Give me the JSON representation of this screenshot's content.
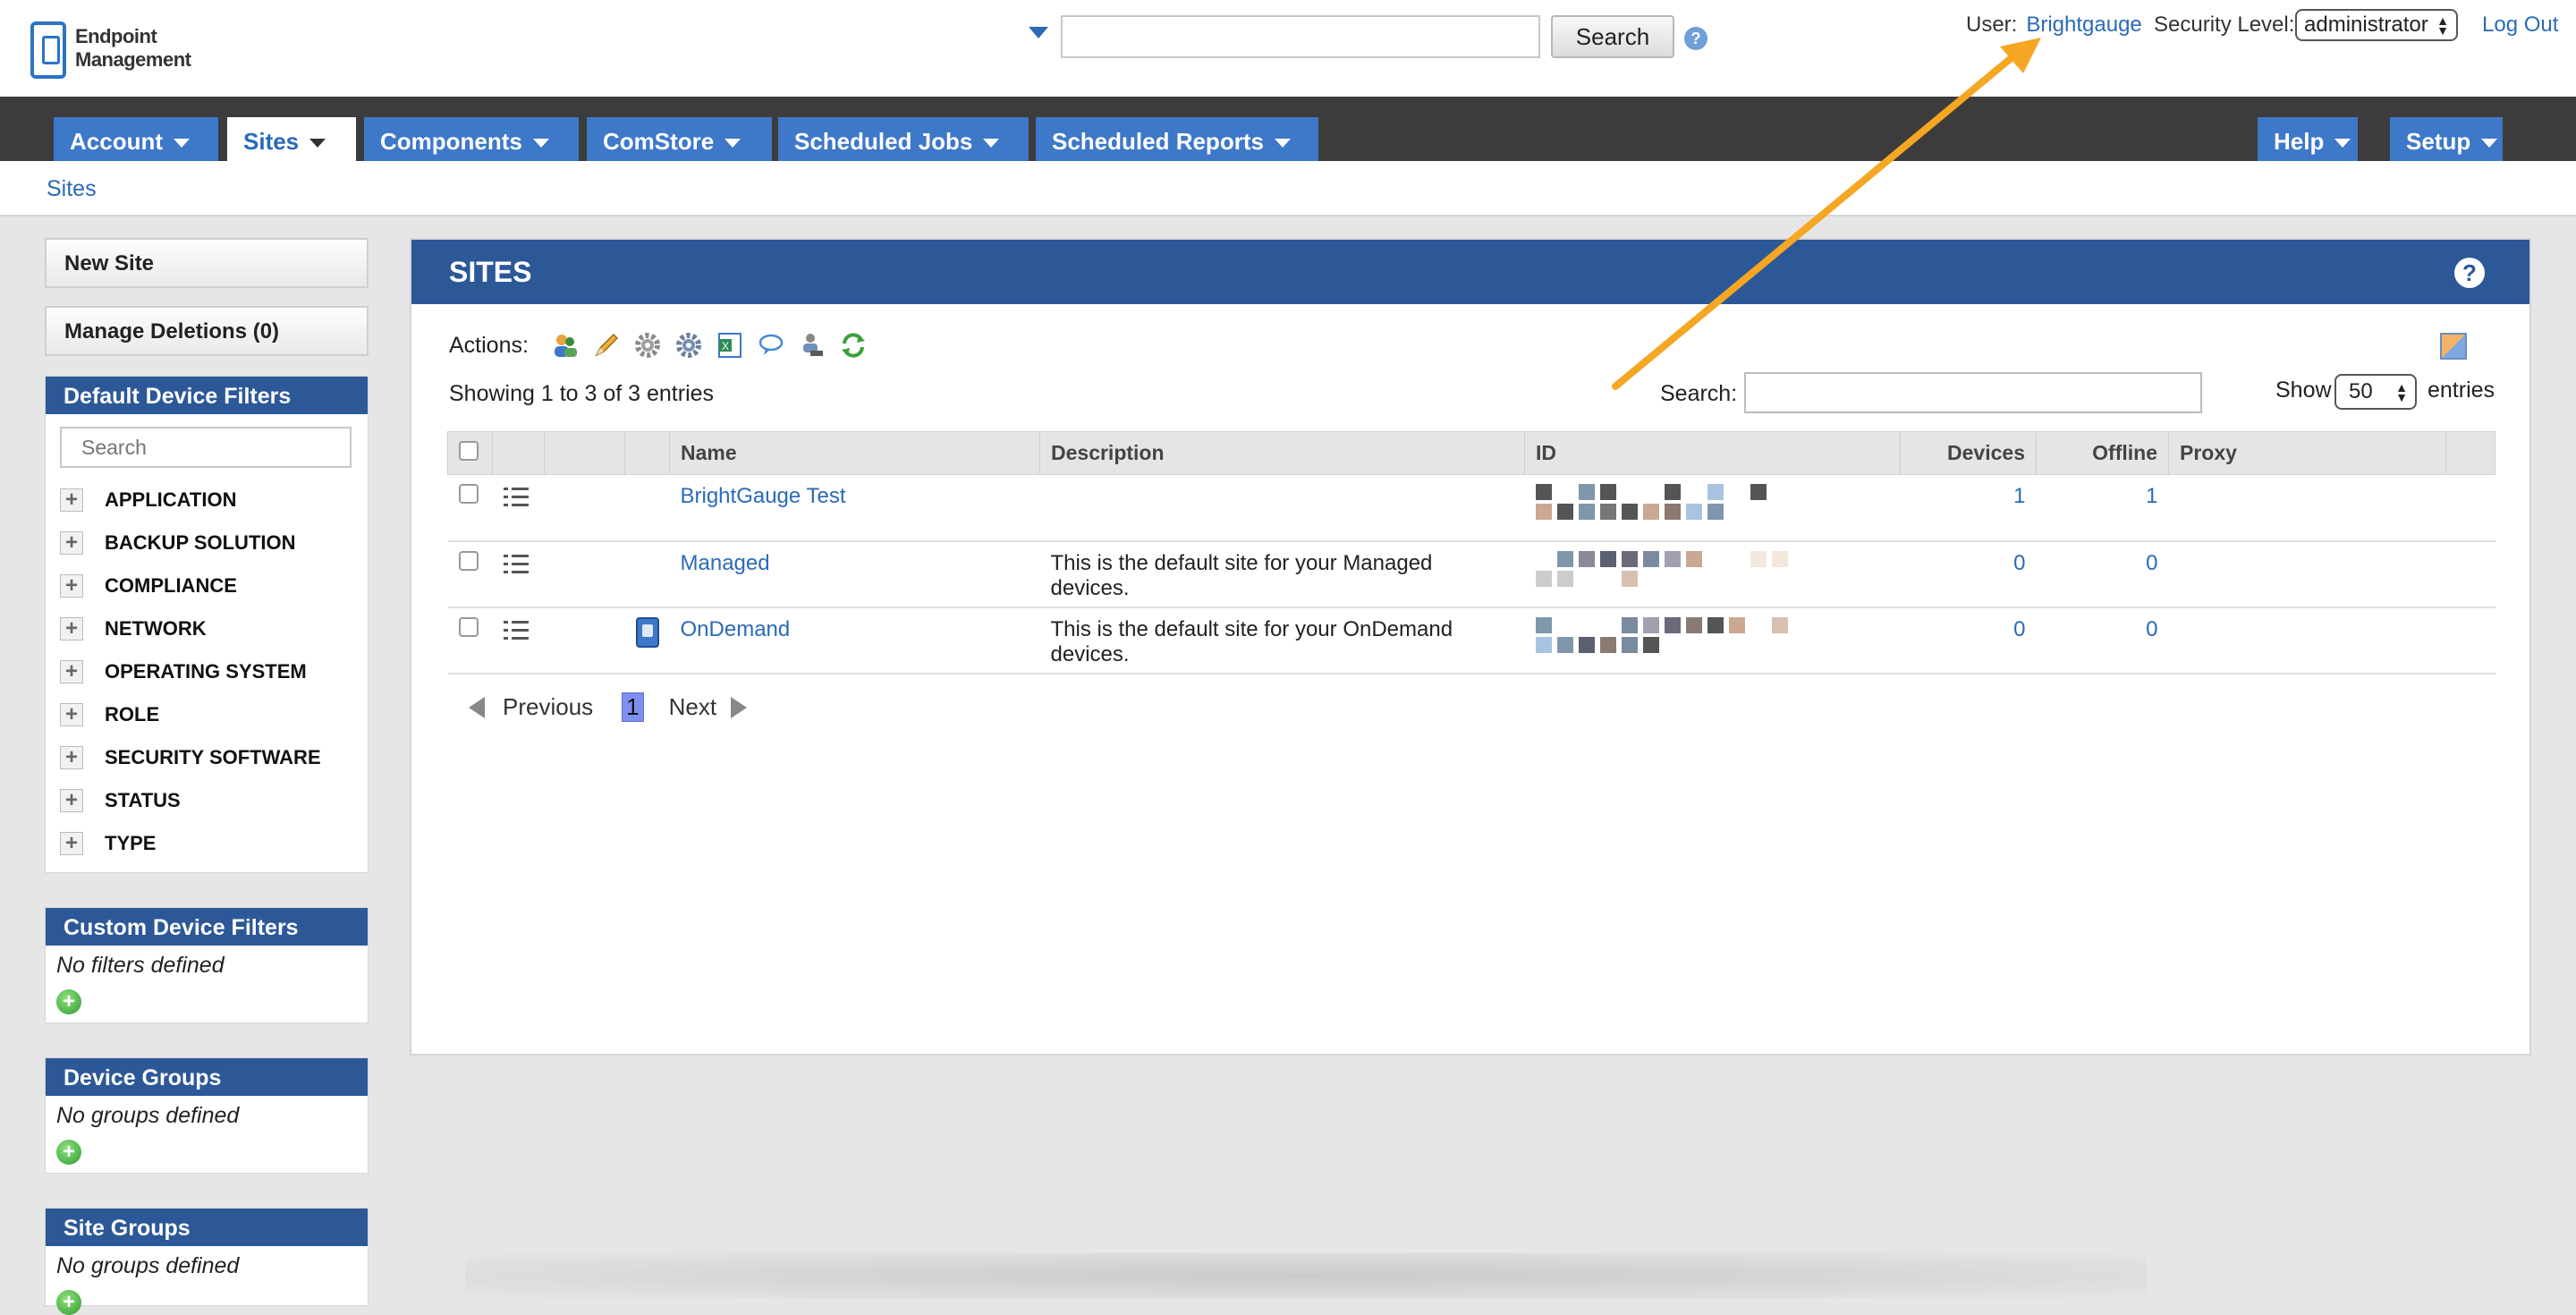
{
  "app": {
    "logo_line1": "Endpoint",
    "logo_line2": "Management"
  },
  "header": {
    "search_value": "",
    "search_button": "Search",
    "help_icon": "question-circle-icon",
    "user_label": "User:",
    "username": "Brightgauge",
    "security_label": "Security Level:",
    "security_value": "administrator",
    "logout": "Log Out"
  },
  "nav": {
    "tabs": [
      {
        "label": "Account"
      },
      {
        "label": "Sites",
        "active": true
      },
      {
        "label": "Components"
      },
      {
        "label": "ComStore"
      },
      {
        "label": "Scheduled Jobs"
      },
      {
        "label": "Scheduled Reports"
      },
      {
        "label": "Help"
      },
      {
        "label": "Setup"
      }
    ]
  },
  "breadcrumb": "Sites",
  "sidebar": {
    "new_site": "New Site",
    "manage_deletions": "Manage Deletions (0)",
    "default_filters": {
      "title": "Default Device Filters",
      "search_placeholder": "Search",
      "items": [
        "APPLICATION",
        "BACKUP SOLUTION",
        "COMPLIANCE",
        "NETWORK",
        "OPERATING SYSTEM",
        "ROLE",
        "SECURITY SOFTWARE",
        "STATUS",
        "TYPE"
      ]
    },
    "custom_filters": {
      "title": "Custom Device Filters",
      "empty": "No filters defined"
    },
    "device_groups": {
      "title": "Device Groups",
      "empty": "No groups defined"
    },
    "site_groups": {
      "title": "Site Groups",
      "empty": "No groups defined"
    }
  },
  "main": {
    "title": "SITES",
    "actions_label": "Actions:",
    "action_icons": [
      "users-icon",
      "pencil-icon",
      "gear-icon",
      "gears-icon",
      "excel-icon",
      "comment-icon",
      "user-transfer-icon",
      "refresh-icon"
    ],
    "showing": "Showing 1 to 3 of 3 entries",
    "search_label": "Search:",
    "search_value": "",
    "show_label": "Show",
    "show_value": "50",
    "entries_label": "entries",
    "columns": [
      "Name",
      "Description",
      "ID",
      "Devices",
      "Offline",
      "Proxy"
    ],
    "rows": [
      {
        "name": "BrightGauge Test",
        "description": "",
        "devices": "1",
        "offline": "1",
        "proxy": "",
        "ondemand": false
      },
      {
        "name": "Managed",
        "description": "This is the default site for your Managed devices.",
        "devices": "0",
        "offline": "0",
        "proxy": "",
        "ondemand": false
      },
      {
        "name": "OnDemand",
        "description": "This is the default site for your OnDemand devices.",
        "devices": "0",
        "offline": "0",
        "proxy": "",
        "ondemand": true
      }
    ],
    "pager": {
      "previous": "Previous",
      "page": "1",
      "next": "Next"
    }
  },
  "colors": {
    "nav_blue": "#3d78c9",
    "panel_header": "#2c5897",
    "link": "#2a6ab8",
    "annotation_arrow": "#f5a623"
  }
}
